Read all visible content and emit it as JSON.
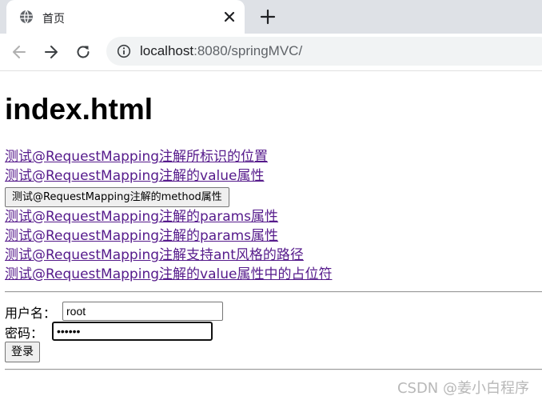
{
  "browser": {
    "tab_title": "首页",
    "url_host": "localhost",
    "url_rest": ":8080/springMVC/"
  },
  "page": {
    "heading": "index.html",
    "links": [
      "测试@RequestMapping注解所标识的位置",
      "测试@RequestMapping注解的value属性"
    ],
    "method_button": "测试@RequestMapping注解的method属性",
    "links2": [
      "测试@RequestMapping注解的params属性",
      "测试@RequestMapping注解的params属性",
      "测试@RequestMapping注解支持ant风格的路径",
      "测试@RequestMapping注解的value属性中的占位符"
    ],
    "form": {
      "username_label": "用户名：",
      "username_value": "root",
      "password_label": "密码：",
      "password_value": "••••••",
      "submit_label": "登录"
    }
  },
  "watermark": "CSDN @姜小白程序"
}
